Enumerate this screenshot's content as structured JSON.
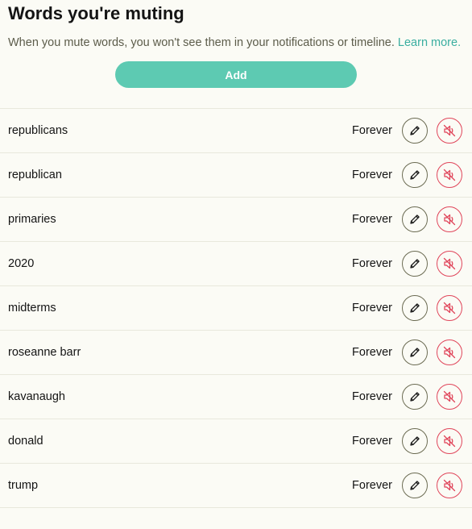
{
  "page": {
    "title": "Words you're muting",
    "description": "When you mute words, you won't see them in your notifications or timeline.",
    "learn_more": "Learn more.",
    "add_label": "Add"
  },
  "muted_words": [
    {
      "word": "republicans",
      "duration": "Forever"
    },
    {
      "word": "republican",
      "duration": "Forever"
    },
    {
      "word": "primaries",
      "duration": "Forever"
    },
    {
      "word": "2020",
      "duration": "Forever"
    },
    {
      "word": "midterms",
      "duration": "Forever"
    },
    {
      "word": "roseanne barr",
      "duration": "Forever"
    },
    {
      "word": "kavanaugh",
      "duration": "Forever"
    },
    {
      "word": "donald",
      "duration": "Forever"
    },
    {
      "word": "trump",
      "duration": "Forever"
    }
  ],
  "colors": {
    "accent": "#5dcab2",
    "link": "#3aaea0",
    "danger": "#e0455a",
    "background": "#fbfbf5"
  },
  "icons": {
    "edit": "pencil-icon",
    "unmute": "muted-speaker-icon"
  }
}
